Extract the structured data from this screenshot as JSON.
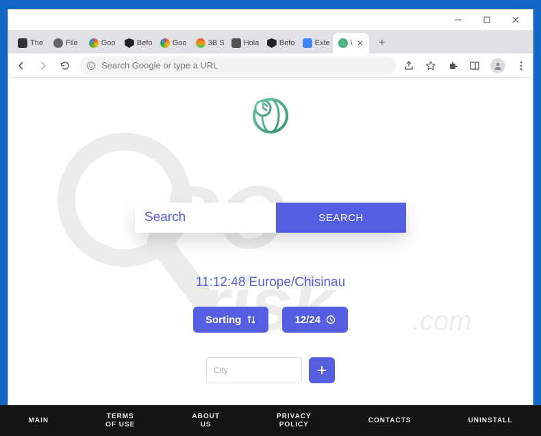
{
  "window": {
    "controls": {
      "minimize": "–",
      "maximize": "▢",
      "close": "✕"
    }
  },
  "tabs": [
    {
      "label": "The",
      "favicon": "print"
    },
    {
      "label": "File",
      "favicon": "globe"
    },
    {
      "label": "Goo",
      "favicon": "google"
    },
    {
      "label": "Befo",
      "favicon": "shield"
    },
    {
      "label": "Goo",
      "favicon": "google"
    },
    {
      "label": "3B S",
      "favicon": "color"
    },
    {
      "label": "Hola",
      "favicon": "download"
    },
    {
      "label": "Befo",
      "favicon": "shield"
    },
    {
      "label": "Exte",
      "favicon": "puzzle"
    },
    {
      "label": "\\",
      "favicon": "greenglobe",
      "active": true
    }
  ],
  "omnibox": {
    "placeholder": "Search Google or type a URL"
  },
  "page": {
    "search": {
      "placeholder": "Search",
      "button": "SEARCH"
    },
    "clock": "11:12:48 Europe/Chisinau",
    "sorting_label": "Sorting",
    "timefmt_label": "12/24",
    "city_placeholder": "City"
  },
  "footer": {
    "items": [
      "MAIN",
      "TERMS\nOF USE",
      "ABOUT\nUS",
      "PRIVACY\nPOLICY",
      "CONTACTS",
      "UNINSTALL"
    ]
  }
}
